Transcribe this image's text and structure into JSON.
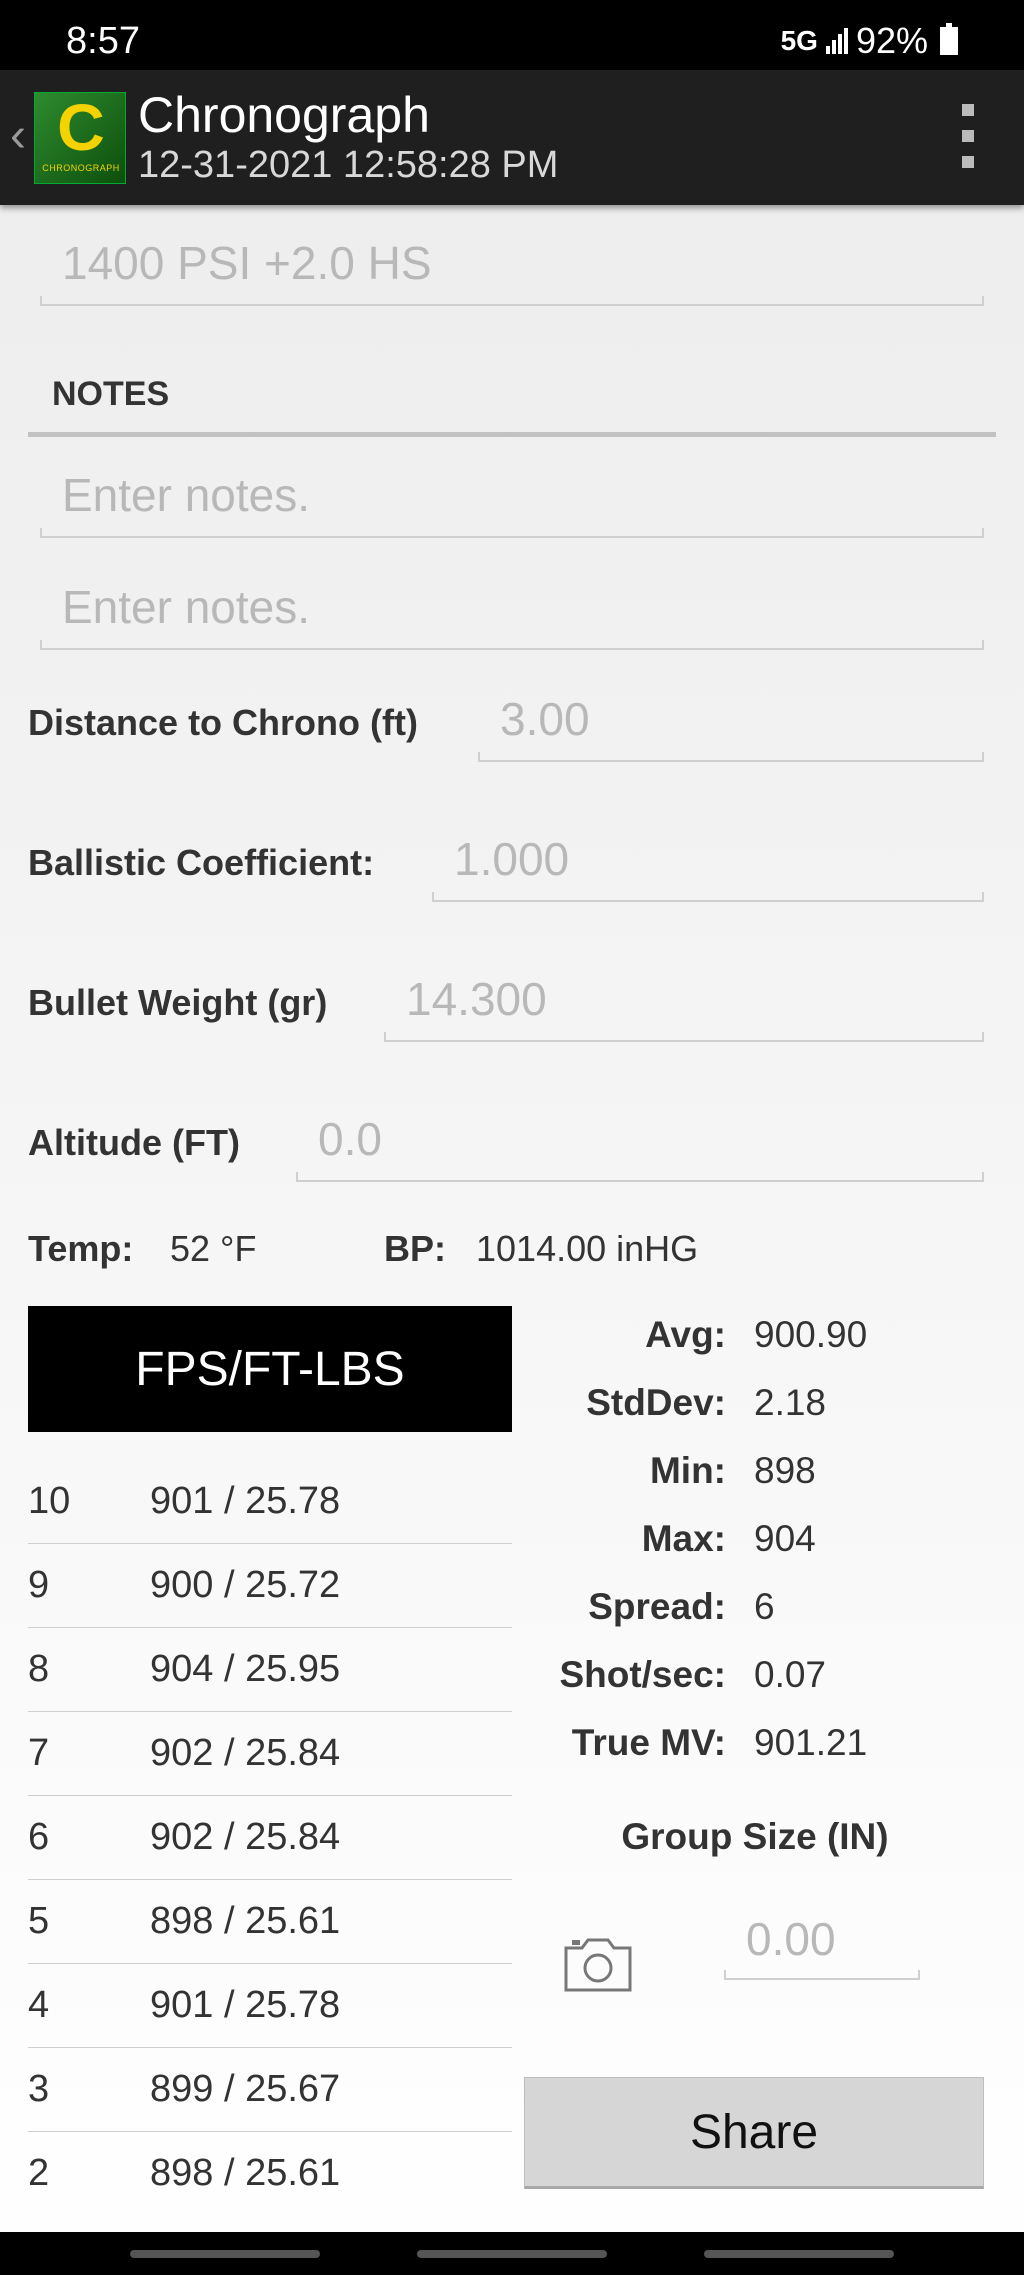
{
  "status_bar": {
    "time": "8:57",
    "network": "5G",
    "battery": "92%"
  },
  "header": {
    "title": "Chronograph",
    "subtitle": "12-31-2021 12:58:28 PM",
    "logo_text": "CHRONOGRAPH",
    "logo_letter": "C"
  },
  "top_field": {
    "value": "1400 PSI +2.0 HS"
  },
  "notes": {
    "header": "NOTES",
    "note1_placeholder": "Enter notes.",
    "note2_placeholder": "Enter notes."
  },
  "fields": {
    "distance": {
      "label": "Distance to Chrono (ft)",
      "value": "3.00"
    },
    "bc": {
      "label": "Ballistic Coefficient:",
      "value": "1.000"
    },
    "weight": {
      "label": "Bullet Weight (gr)",
      "value": "14.300"
    },
    "altitude": {
      "label": "Altitude (FT)",
      "value": "0.0"
    }
  },
  "conditions": {
    "temp_label": "Temp:",
    "temp_value": "52 °F",
    "bp_label": "BP:",
    "bp_value": "1014.00 inHG"
  },
  "units_button": "FPS/FT-LBS",
  "shots": [
    {
      "num": "10",
      "value": "901 / 25.78"
    },
    {
      "num": "9",
      "value": "900 / 25.72"
    },
    {
      "num": "8",
      "value": "904 / 25.95"
    },
    {
      "num": "7",
      "value": "902 / 25.84"
    },
    {
      "num": "6",
      "value": "902 / 25.84"
    },
    {
      "num": "5",
      "value": "898 / 25.61"
    },
    {
      "num": "4",
      "value": "901 / 25.78"
    },
    {
      "num": "3",
      "value": "899 / 25.67"
    },
    {
      "num": "2",
      "value": "898 / 25.61"
    }
  ],
  "stats": [
    {
      "label": "Avg:",
      "value": "900.90"
    },
    {
      "label": "StdDev:",
      "value": "2.18"
    },
    {
      "label": "Min:",
      "value": "898"
    },
    {
      "label": "Max:",
      "value": "904"
    },
    {
      "label": "Spread:",
      "value": "6"
    },
    {
      "label": "Shot/sec:",
      "value": "0.07"
    },
    {
      "label": "True MV:",
      "value": "901.21"
    }
  ],
  "group_size": {
    "title": "Group Size (IN)",
    "value": "0.00"
  },
  "share_label": "Share",
  "icons": {
    "camera": "camera-icon",
    "back": "back-caret-icon",
    "menu": "overflow-menu-icon"
  }
}
